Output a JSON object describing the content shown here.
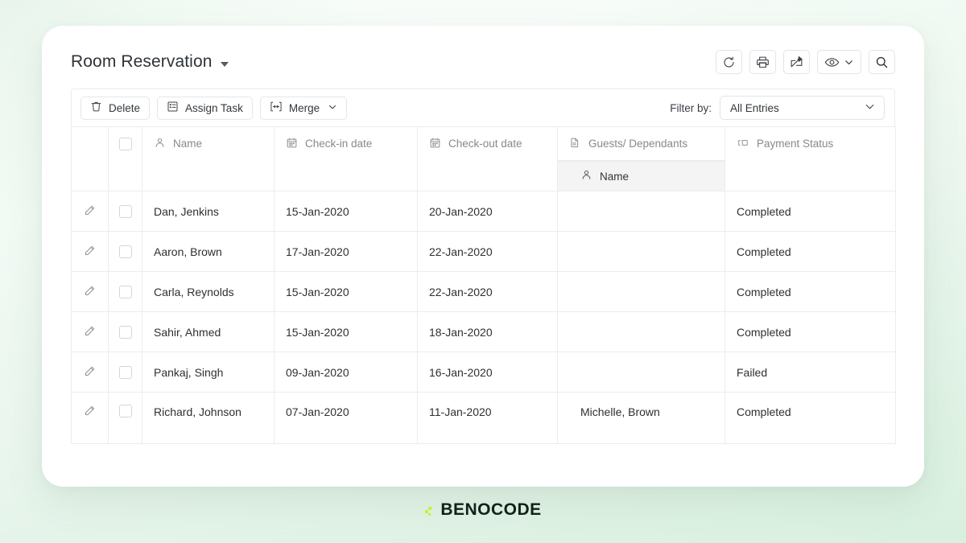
{
  "header": {
    "title": "Room Reservation",
    "title_caret_icon": "chevron-down-icon",
    "tools": [
      {
        "name": "refresh-button",
        "icon": "refresh-icon"
      },
      {
        "name": "print-button",
        "icon": "printer-icon"
      },
      {
        "name": "share-button",
        "icon": "share-icon"
      },
      {
        "name": "view-button",
        "icon": "eye-icon"
      },
      {
        "name": "search-button",
        "icon": "search-icon"
      }
    ]
  },
  "toolbar": {
    "delete_label": "Delete",
    "assign_task_label": "Assign Task",
    "merge_label": "Merge",
    "filter_label": "Filter by:",
    "filter_value": "All Entries",
    "filter_options": [
      "All Entries"
    ]
  },
  "table": {
    "columns": [
      {
        "key": "edit",
        "label": "",
        "icon": ""
      },
      {
        "key": "select",
        "label": "",
        "icon": "checkbox-icon"
      },
      {
        "key": "name",
        "label": "Name",
        "icon": "person-icon"
      },
      {
        "key": "checkin",
        "label": "Check-in date",
        "icon": "calendar-icon"
      },
      {
        "key": "checkout",
        "label": "Check-out date",
        "icon": "calendar-icon"
      },
      {
        "key": "guests",
        "label": "Guests/ Dependants",
        "icon": "document-icon"
      },
      {
        "key": "payment",
        "label": "Payment Status",
        "icon": "status-tag-icon"
      }
    ],
    "sub_header": {
      "label": "Name",
      "icon": "person-icon"
    },
    "rows": [
      {
        "name": "Dan, Jenkins",
        "checkin": "15-Jan-2020",
        "checkout": "20-Jan-2020",
        "guest": "",
        "payment": "Completed"
      },
      {
        "name": "Aaron, Brown",
        "checkin": "17-Jan-2020",
        "checkout": "22-Jan-2020",
        "guest": "",
        "payment": "Completed"
      },
      {
        "name": "Carla, Reynolds",
        "checkin": "15-Jan-2020",
        "checkout": "22-Jan-2020",
        "guest": "",
        "payment": "Completed"
      },
      {
        "name": "Sahir, Ahmed",
        "checkin": "15-Jan-2020",
        "checkout": "18-Jan-2020",
        "guest": "",
        "payment": "Completed"
      },
      {
        "name": "Pankaj, Singh",
        "checkin": "09-Jan-2020",
        "checkout": "16-Jan-2020",
        "guest": "",
        "payment": "Failed"
      },
      {
        "name": "Richard, Johnson",
        "checkin": "07-Jan-2020",
        "checkout": "11-Jan-2020",
        "guest": "Michelle, Brown",
        "payment": "Completed"
      }
    ]
  },
  "footer": {
    "logo_text": "BENOCODE",
    "logo_accent_color": "#c8f03c",
    "logo_text_color": "#12201a"
  }
}
